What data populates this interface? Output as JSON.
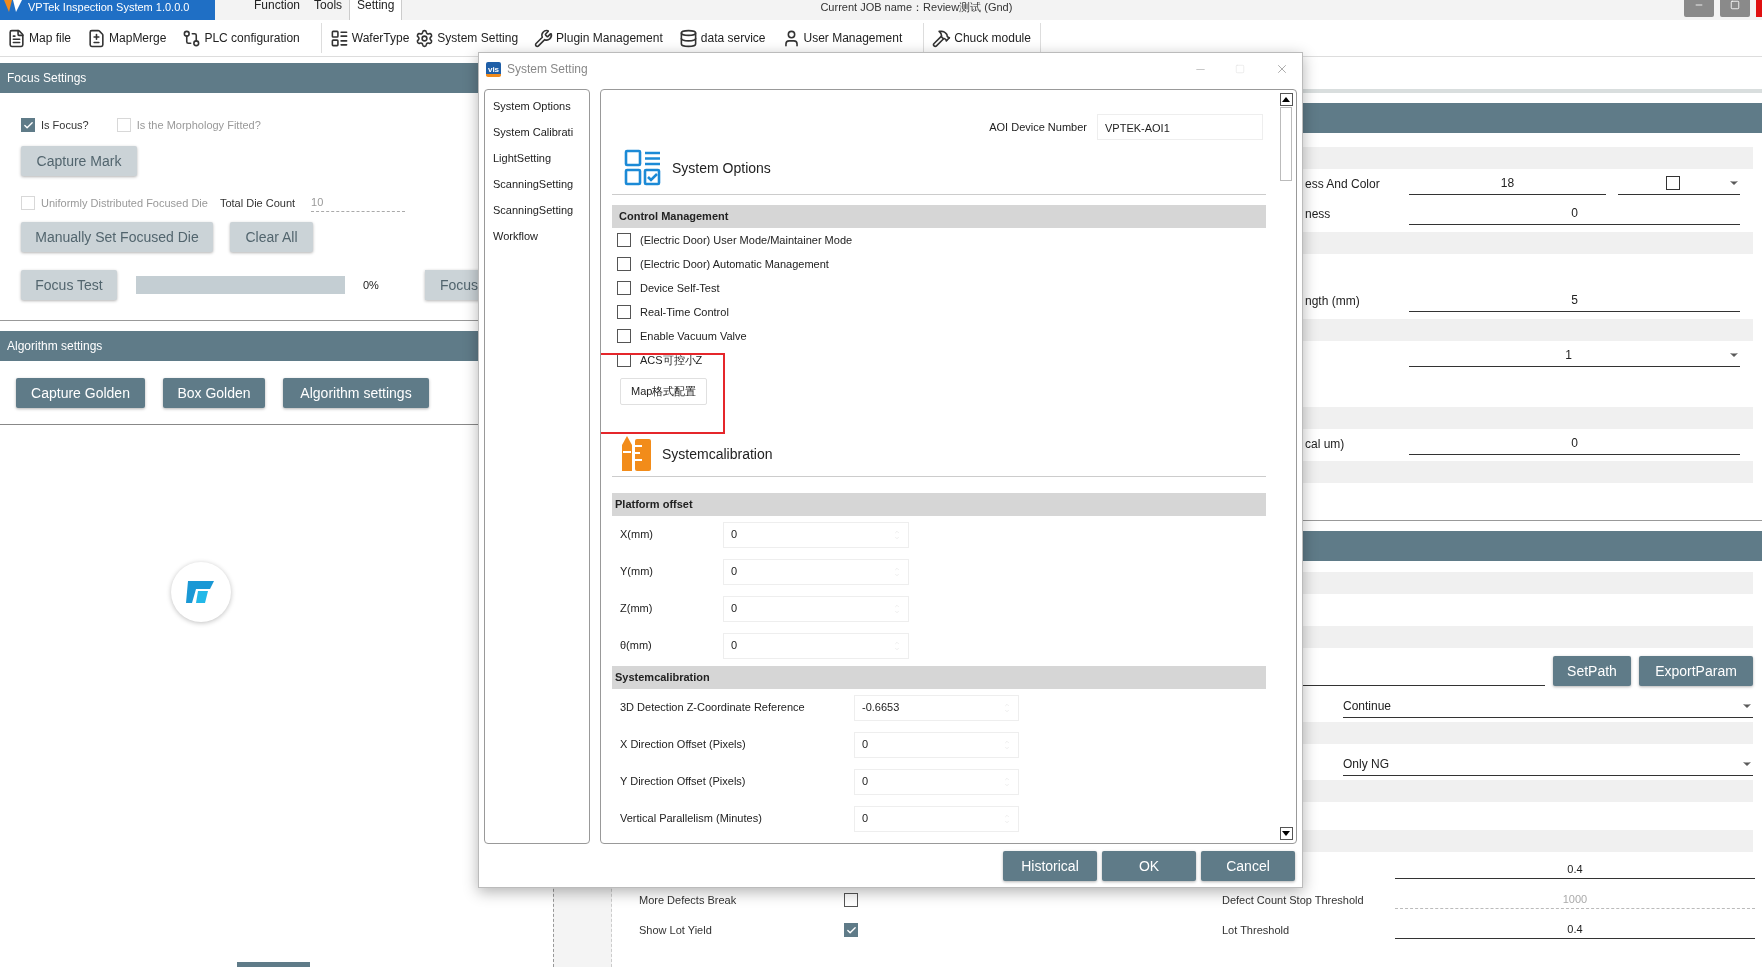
{
  "titlebar": {
    "app_title": "VPTek Inspection System 1.0.0.0",
    "menu": [
      {
        "label": "Function",
        "selected": false
      },
      {
        "label": "Tools",
        "selected": false
      },
      {
        "label": "Setting",
        "selected": true
      }
    ],
    "job": "Current JOB name：Review测试 (Gnd)"
  },
  "toolbar": [
    {
      "label": "Map file"
    },
    {
      "label": "MapMerge"
    },
    {
      "label": "PLC configuration"
    },
    {
      "label": "WaferType"
    },
    {
      "label": "System Setting"
    },
    {
      "label": "Plugin Management"
    },
    {
      "label": "data service"
    },
    {
      "label": "User Management"
    },
    {
      "label": "Chuck module"
    }
  ],
  "focus_settings": {
    "title": "Focus Settings",
    "is_focus": {
      "label": "Is Focus?",
      "checked": true
    },
    "morphology": {
      "label": "Is the Morphology Fitted?",
      "checked": false,
      "disabled": true
    },
    "capture_mark": {
      "label": "Capture Mark",
      "disabled": true
    },
    "uniform": {
      "label": "Uniformly Distributed Focused Die",
      "checked": false,
      "disabled": true
    },
    "total_die_label": "Total Die Count",
    "total_die_value": "10",
    "manual_button": {
      "label": "Manually Set Focused Die",
      "disabled": true
    },
    "clear_button": {
      "label": "Clear All",
      "disabled": true
    },
    "focus_test": {
      "label": "Focus Test",
      "disabled": true
    },
    "progress": {
      "level": 0,
      "reading": "0%"
    },
    "focus_partial": {
      "label": "Focus",
      "disabled": true
    }
  },
  "algorithm_settings": {
    "title": "Algorithm settings",
    "buttons": [
      "Capture Golden",
      "Box Golden",
      "Algorithm settings"
    ]
  },
  "right_panel": {
    "upper_rows": [
      {
        "kind": "color",
        "label": "ess And Color",
        "value": "18"
      },
      {
        "kind": "field",
        "label": "ness",
        "value": "0"
      },
      {
        "kind": "field",
        "label": "ngth (mm)",
        "value": "5"
      },
      {
        "kind": "select",
        "value": "1"
      },
      {
        "kind": "field",
        "label": "cal um)",
        "value": "0"
      }
    ],
    "path_buttons": [
      "SetPath",
      "ExportParam"
    ],
    "selects": [
      "Continue",
      "Only NG"
    ],
    "bottom_rows": [
      {
        "threshold_value": "0.4",
        "threshold_disabled": false
      },
      {
        "label": "More Defects Break",
        "checked": false,
        "threshold_label": "Defect Count Stop Threshold",
        "threshold_value": "1000",
        "threshold_disabled": true
      },
      {
        "label": "Show Lot Yield",
        "checked": true,
        "threshold_label": "Lot Threshold",
        "threshold_value": "0.4",
        "threshold_disabled": false
      }
    ]
  },
  "dialog": {
    "icon_text": "vis",
    "title": "System Setting",
    "nav": [
      "System Options",
      "System Calibrati",
      "LightSetting",
      "ScanningSetting",
      "ScanningSetting",
      "Workflow"
    ],
    "aoi_label": "AOI Device Number",
    "aoi_value": "VPTEK-AOI1",
    "options_title": "System Options",
    "control_header": "Control Management",
    "controls": [
      {
        "label": "(Electric Door) User Mode/Maintainer Mode",
        "checked": false
      },
      {
        "label": "(Electric Door) Automatic Management",
        "checked": false
      },
      {
        "label": "Device Self-Test",
        "checked": false
      },
      {
        "label": "Real-Time Control",
        "checked": false
      },
      {
        "label": "Enable Vacuum Valve",
        "checked": false
      },
      {
        "label": "ACS可控小Z",
        "checked": false
      }
    ],
    "map_button": "Map格式配置",
    "calib_title": "Systemcalibration",
    "platform_header": "Platform offset",
    "platform_rows": [
      {
        "label": "X(mm)",
        "value": "0"
      },
      {
        "label": "Y(mm)",
        "value": "0"
      },
      {
        "label": "Z(mm)",
        "value": "0"
      },
      {
        "label": "θ(mm)",
        "value": "0"
      }
    ],
    "calib_header": "Systemcalibration",
    "calib_rows": [
      {
        "label": "3D Detection Z-Coordinate Reference",
        "value": "-0.6653"
      },
      {
        "label": "X Direction Offset (Pixels)",
        "value": "0"
      },
      {
        "label": "Y Direction Offset (Pixels)",
        "value": "0"
      },
      {
        "label": "Vertical Parallelism (Minutes)",
        "value": "0"
      }
    ],
    "buttons": [
      "Historical",
      "OK",
      "Cancel"
    ]
  }
}
